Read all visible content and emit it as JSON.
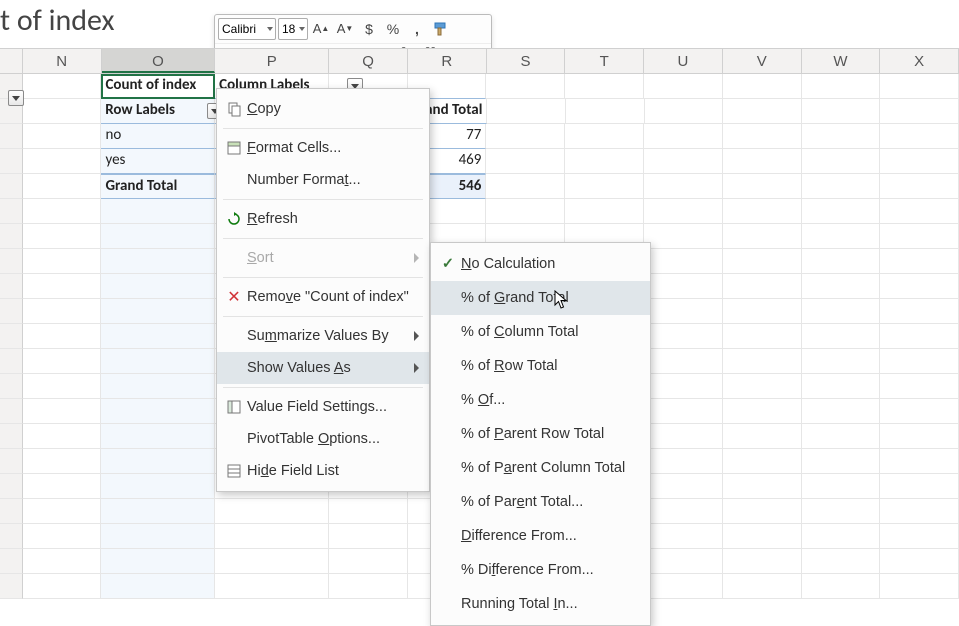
{
  "namebox": {
    "text": "t of index"
  },
  "mini_toolbar": {
    "font": "Calibri",
    "size": "18"
  },
  "columns": [
    "N",
    "O",
    "P",
    "Q",
    "R",
    "S",
    "T",
    "U",
    "V",
    "W",
    "X"
  ],
  "selected_col_index": 1,
  "pivot": {
    "corner": "Count of index",
    "col_field": "Column Labels",
    "row_field": "Row Labels",
    "grand_total_label": "Grand Total",
    "rows": [
      {
        "label": "no",
        "grand_total": "77"
      },
      {
        "label": "yes",
        "grand_total": "469"
      }
    ],
    "grand_total_row": {
      "label": "Grand Total",
      "grand_total": "546"
    }
  },
  "context_menu": {
    "items": [
      {
        "id": "copy",
        "label_pre": "",
        "key": "C",
        "label_post": "opy",
        "icon": "copy",
        "arrow": false
      },
      {
        "id": "format-cells",
        "label_pre": "",
        "key": "F",
        "label_post": "ormat Cells...",
        "icon": "cells",
        "arrow": false
      },
      {
        "id": "number-fmt",
        "label_pre": "Number Forma",
        "key": "t",
        "label_post": "...",
        "icon": "",
        "arrow": false
      },
      {
        "id": "refresh",
        "label_pre": "",
        "key": "R",
        "label_post": "efresh",
        "icon": "refresh",
        "arrow": false
      },
      {
        "id": "sort",
        "label_pre": "",
        "key": "S",
        "label_post": "ort",
        "icon": "",
        "arrow": true,
        "disabled": true
      },
      {
        "id": "remove",
        "label_pre": "Remo",
        "key": "v",
        "label_post": "e \"Count of index\"",
        "icon": "remove",
        "arrow": false
      },
      {
        "id": "summarize",
        "label_pre": "Su",
        "key": "m",
        "label_post": "marize Values By",
        "icon": "",
        "arrow": true
      },
      {
        "id": "showvalues",
        "label_pre": "Show Values ",
        "key": "A",
        "label_post": "s",
        "icon": "",
        "arrow": true,
        "hover": true
      },
      {
        "id": "vfs",
        "label_pre": "Value Field Settings...",
        "key": "",
        "label_post": "",
        "icon": "vfs",
        "arrow": false
      },
      {
        "id": "ptopts",
        "label_pre": "PivotTable ",
        "key": "O",
        "label_post": "ptions...",
        "icon": "",
        "arrow": false
      },
      {
        "id": "hide",
        "label_pre": "Hi",
        "key": "d",
        "label_post": "e Field List",
        "icon": "list",
        "arrow": false
      }
    ]
  },
  "submenu": {
    "items": [
      {
        "id": "nocalc",
        "label_pre": "",
        "key": "N",
        "label_post": "o Calculation",
        "checked": true
      },
      {
        "id": "gt",
        "label_pre": "% of ",
        "key": "G",
        "label_post": "rand Total",
        "hover": true
      },
      {
        "id": "coltot",
        "label_pre": "% of ",
        "key": "C",
        "label_post": "olumn Total"
      },
      {
        "id": "rowtot",
        "label_pre": "% of ",
        "key": "R",
        "label_post": "ow Total"
      },
      {
        "id": "of",
        "label_pre": "% ",
        "key": "O",
        "label_post": "f..."
      },
      {
        "id": "prow",
        "label_pre": "% of ",
        "key": "P",
        "label_post": "arent Row Total"
      },
      {
        "id": "pcol",
        "label_pre": "% of P",
        "key": "a",
        "label_post": "rent Column Total"
      },
      {
        "id": "ptot",
        "label_pre": "% of Par",
        "key": "e",
        "label_post": "nt Total..."
      },
      {
        "id": "diff",
        "label_pre": "",
        "key": "D",
        "label_post": "ifference From..."
      },
      {
        "id": "pdiff",
        "label_pre": "% Di",
        "key": "f",
        "label_post": "ference From..."
      },
      {
        "id": "runtot",
        "label_pre": "Running Total ",
        "key": "I",
        "label_post": "n..."
      }
    ]
  }
}
